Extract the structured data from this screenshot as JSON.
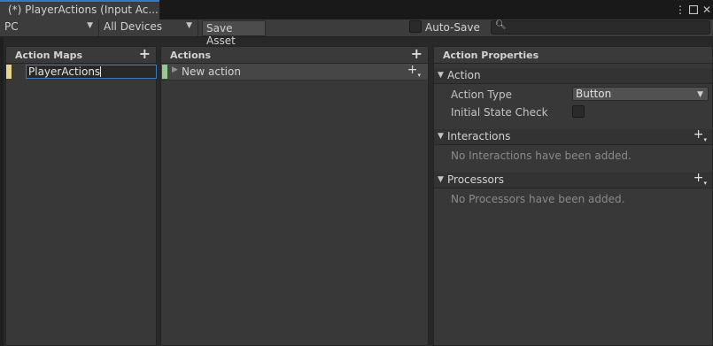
{
  "window": {
    "tab_title": "(*) PlayerActions (Input Ac...",
    "menu_icon": "kebab-menu-icon",
    "maximize_icon": "maximize-icon",
    "close_icon": "close-icon"
  },
  "toolbar": {
    "control_scheme": "PC",
    "devices": "All Devices",
    "save_label": "Save Asset",
    "autosave_label": "Auto-Save",
    "autosave_checked": false,
    "search_value": ""
  },
  "maps_panel": {
    "title": "Action Maps",
    "items": [
      {
        "name": "PlayerActions",
        "color": "#e8d48b",
        "editing": true
      }
    ]
  },
  "actions_panel": {
    "title": "Actions",
    "items": [
      {
        "name": "New action",
        "color": "#96c98c",
        "selected": true
      }
    ]
  },
  "properties_panel": {
    "title": "Action Properties",
    "action_section": "Action",
    "action_type_label": "Action Type",
    "action_type_value": "Button",
    "initial_state_label": "Initial State Check",
    "initial_state_checked": false,
    "interactions_section": "Interactions",
    "interactions_empty": "No Interactions have been added.",
    "processors_section": "Processors",
    "processors_empty": "No Processors have been added."
  }
}
